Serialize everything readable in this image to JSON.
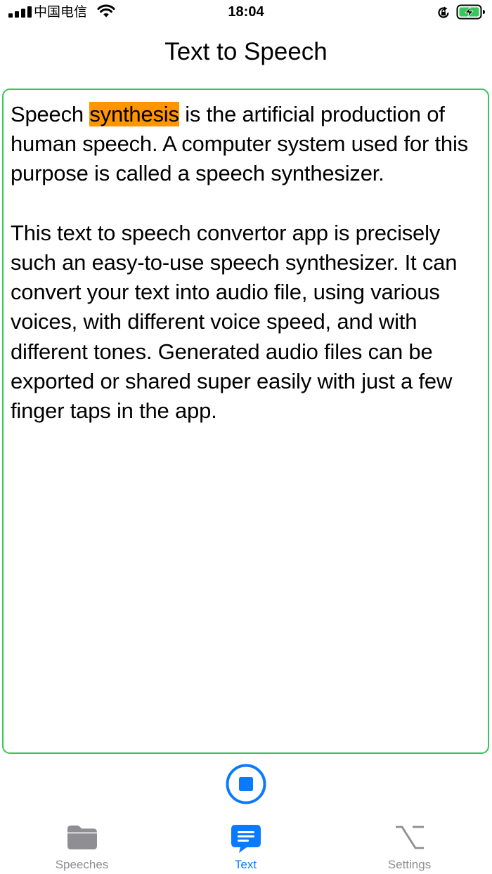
{
  "status_bar": {
    "carrier": "中国电信",
    "time": "18:04"
  },
  "nav": {
    "title": "Text to Speech"
  },
  "editor": {
    "before_highlight": "Speech ",
    "highlight": "synthesis",
    "after_highlight": " is the artificial production of human speech. A computer system used for this purpose is called a speech synthesizer.",
    "paragraph2": "This text to speech convertor app is precisely such an easy-to-use speech synthesizer. It can convert your text into audio file, using various voices, with different voice speed, and with different tones. Generated audio files can be exported or shared super easily with just a few finger taps in the app."
  },
  "tabs": [
    {
      "label": "Speeches",
      "icon": "folder-icon",
      "active": false
    },
    {
      "label": "Text",
      "icon": "text-bubble-icon",
      "active": true
    },
    {
      "label": "Settings",
      "icon": "option-key-icon",
      "active": false
    }
  ],
  "colors": {
    "accent": "#0a7aff",
    "editor_border": "#34c759",
    "highlight": "#ff9500",
    "inactive": "#8e8e93"
  }
}
